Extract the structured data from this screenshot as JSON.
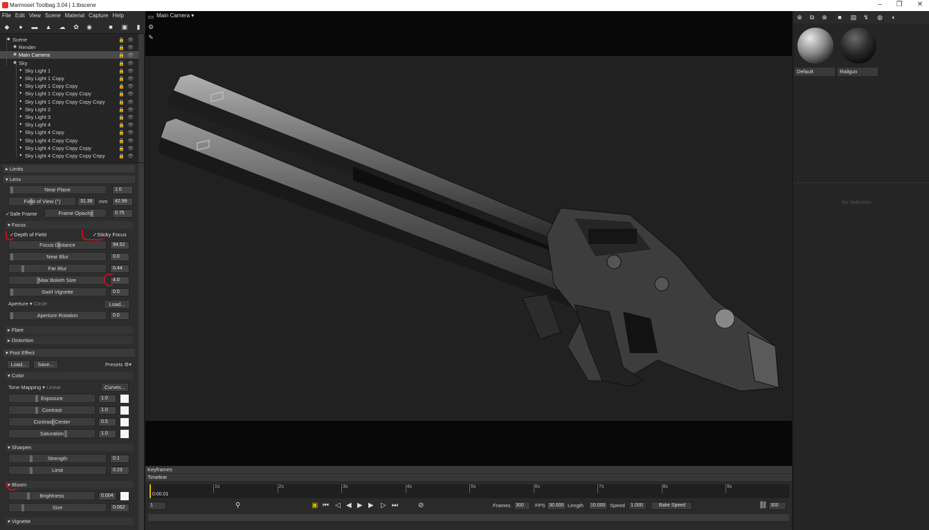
{
  "window": {
    "title": "Marmoset Toolbag 3.04  |  1.tbscene",
    "min": "–",
    "restore": "❐",
    "close": "✕"
  },
  "menu": [
    "File",
    "Edit",
    "View",
    "Scene",
    "Material",
    "Capture",
    "Help"
  ],
  "outliner": {
    "items": [
      {
        "label": "Scene",
        "depth": 0
      },
      {
        "label": "Render",
        "depth": 1
      },
      {
        "label": "Main Camera",
        "depth": 1,
        "selected": true
      },
      {
        "label": "Sky",
        "depth": 1
      },
      {
        "label": "Sky Light 1",
        "depth": 2
      },
      {
        "label": "Sky Light 1 Copy",
        "depth": 2
      },
      {
        "label": "Sky Light 1 Copy Copy",
        "depth": 2
      },
      {
        "label": "Sky Light 1 Copy Copy Copy",
        "depth": 2
      },
      {
        "label": "Sky Light 1 Copy Copy Copy Copy",
        "depth": 2
      },
      {
        "label": "Sky Light 2",
        "depth": 2
      },
      {
        "label": "Sky Light 3",
        "depth": 2
      },
      {
        "label": "Sky Light 4",
        "depth": 2
      },
      {
        "label": "Sky Light 4 Copy",
        "depth": 2
      },
      {
        "label": "Sky Light 4 Copy Copy",
        "depth": 2
      },
      {
        "label": "Sky Light 4 Copy Copy Copy",
        "depth": 2
      },
      {
        "label": "Sky Light 4 Copy Copy Copy Copy",
        "depth": 2
      }
    ]
  },
  "props": {
    "limits": "Limits",
    "lens": "Lens",
    "near_plane": {
      "label": "Near Plane",
      "value": "1.0"
    },
    "fov": {
      "label": "Field of View (°)",
      "value": "31.38",
      "unit": "mm",
      "mm": "42.99"
    },
    "safe_frame": "Safe Frame",
    "frame_opacity": {
      "label": "Frame Opacity",
      "value": "0.75"
    },
    "focus": "Focus",
    "depth_of_field": "Depth of Field",
    "sticky_focus": "Sticky Focus",
    "focus_distance": {
      "label": "Focus Distance",
      "value": "94.52"
    },
    "near_blur": {
      "label": "Near Blur",
      "value": "0.0"
    },
    "far_blur": {
      "label": "Far Blur",
      "value": "0.44"
    },
    "max_bokeh": {
      "label": "Max Bokeh Size",
      "value": "4.0"
    },
    "swirl_vignette": {
      "label": "Swirl Vignette",
      "value": "0.0"
    },
    "aperture": {
      "label": "Aperture",
      "value": "Circle",
      "load": "Load..."
    },
    "aperture_rotation": {
      "label": "Aperture Rotation",
      "value": "0.0"
    },
    "flare": "Flare",
    "distortion": "Distortion",
    "post_effect": "Post Effect",
    "load": "Load...",
    "save": "Save...",
    "presets": "Presets",
    "color": "Color",
    "tone_mapping": {
      "label": "Tone Mapping",
      "value": "Linear",
      "curves": "Curves..."
    },
    "exposure": {
      "label": "Exposure",
      "value": "1.0"
    },
    "contrast": {
      "label": "Contrast",
      "value": "1.0"
    },
    "contrast_center": {
      "label": "Contrast Center",
      "value": "0.5"
    },
    "saturation": {
      "label": "Saturation",
      "value": "1.0"
    },
    "sharpen": "Sharpen",
    "strength": {
      "label": "Strength",
      "value": "0.1"
    },
    "limit": {
      "label": "Limit",
      "value": "0.23"
    },
    "bloom": "Bloom",
    "brightness": {
      "label": "Brightness",
      "value": "0.004"
    },
    "size": {
      "label": "Size",
      "value": "0.062"
    },
    "vignette": "Vignette"
  },
  "viewport": {
    "camera_label": "Main Camera",
    "dropdown": "▾"
  },
  "materials": {
    "tiles": [
      {
        "label": "Default"
      },
      {
        "label": "Railgun"
      }
    ],
    "empty_text": "No Selection"
  },
  "timeline": {
    "keyframes": "Keyframes",
    "timeline": "Timeline",
    "current_time": "0:00.01",
    "ticks": [
      "1s",
      "2s",
      "3s",
      "4s",
      "5s",
      "6s",
      "7s",
      "8s",
      "9s"
    ],
    "frame_field": "1",
    "frames_label": "Frames",
    "frames": "300",
    "fps_label": "FPS",
    "fps": "30.000",
    "length_label": "Length",
    "length": "10.000",
    "speed_label": "Speed",
    "speed": "1.000",
    "bake_speed": "Bake Speed",
    "end_field": "300"
  },
  "colors": {
    "annotation": "#c0111b",
    "bg": "#1a1a1a",
    "panel": "#2d2d2d"
  },
  "icons": [
    "scene-icon",
    "light-icon",
    "camera-icon",
    "search-icon",
    "gear-icon",
    "play-icon"
  ]
}
